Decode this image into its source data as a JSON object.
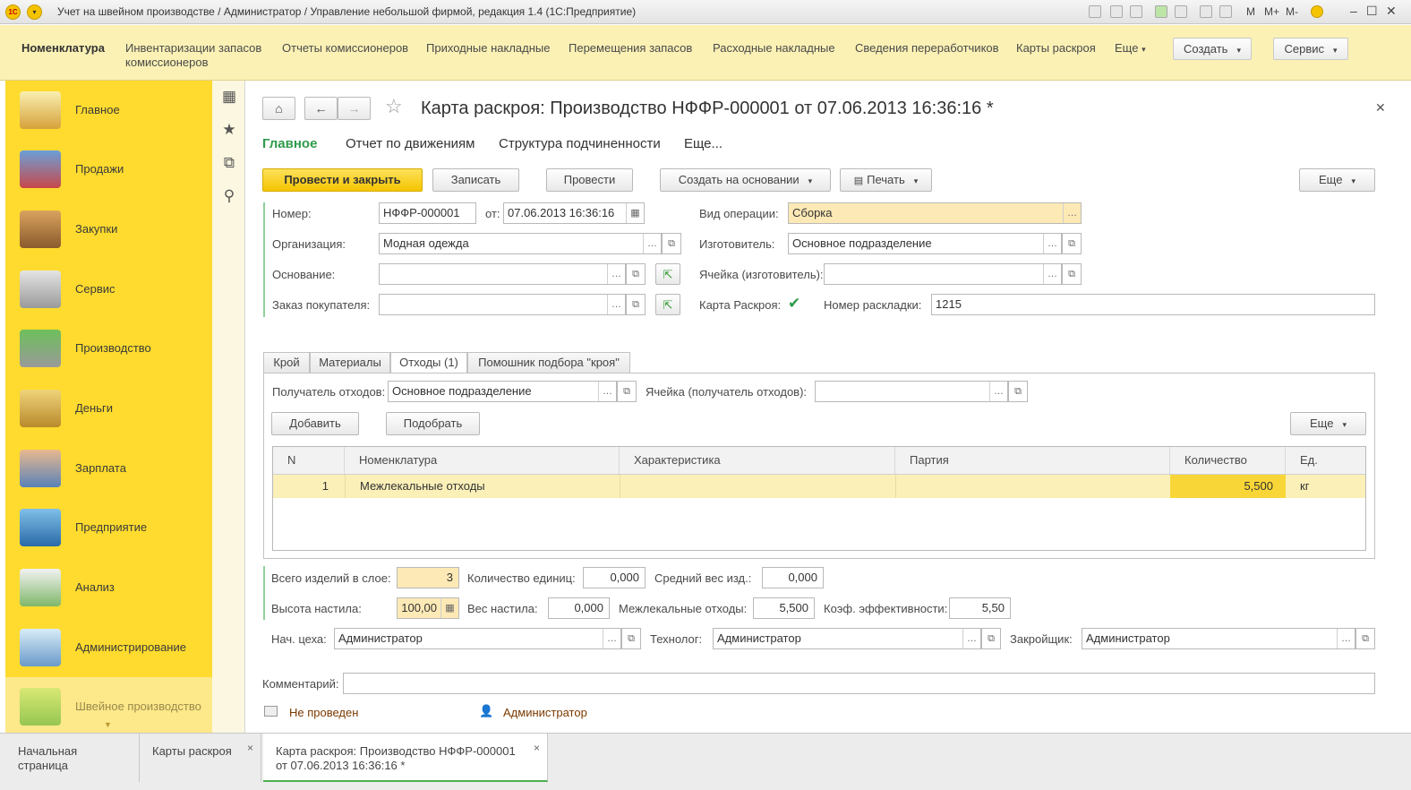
{
  "window": {
    "title": "Учет на швейном производстве / Администратор / Управление небольшой фирмой, редакция 1.4  (1С:Предприятие)",
    "logo_text": "1С",
    "m_labels": [
      "M",
      "M+",
      "M-"
    ]
  },
  "sections": {
    "items": [
      {
        "label": "Номенклатура"
      },
      {
        "label": "Инвентаризации запасов комиссионеров"
      },
      {
        "label": "Отчеты комиссионеров"
      },
      {
        "label": "Приходные накладные"
      },
      {
        "label": "Перемещения запасов"
      },
      {
        "label": "Расходные накладные"
      },
      {
        "label": "Сведения переработчиков"
      },
      {
        "label": "Карты раскроя"
      },
      {
        "label": "Еще"
      }
    ],
    "create_label": "Создать",
    "service_label": "Сервис"
  },
  "nav": [
    {
      "label": "Главное",
      "icon": "desk-lamp-icon"
    },
    {
      "label": "Продажи",
      "icon": "basket-icon"
    },
    {
      "label": "Закупки",
      "icon": "boxes-icon"
    },
    {
      "label": "Сервис",
      "icon": "tools-icon"
    },
    {
      "label": "Производство",
      "icon": "factory-icon"
    },
    {
      "label": "Деньги",
      "icon": "coins-icon"
    },
    {
      "label": "Зарплата",
      "icon": "person-coins-icon"
    },
    {
      "label": "Предприятие",
      "icon": "building-icon"
    },
    {
      "label": "Анализ",
      "icon": "chart-icon"
    },
    {
      "label": "Администрирование",
      "icon": "computer-icon"
    },
    {
      "label": "Швейное производство",
      "icon": "sewing-icon"
    }
  ],
  "doc": {
    "title": "Карта раскроя: Производство НФФР-000001 от 07.06.2013 16:36:16 *",
    "subtabs": [
      "Главное",
      "Отчет по движениям",
      "Структура подчиненности",
      "Еще..."
    ],
    "toolbar": {
      "post_close": "Провести и закрыть",
      "save": "Записать",
      "post": "Провести",
      "create_based": "Создать на основании",
      "print": "Печать",
      "more": "Еще"
    },
    "fields": {
      "number_label": "Номер:",
      "number": "НФФР-000001",
      "from_label": "от:",
      "date": "07.06.2013 16:36:16",
      "org_label": "Организация:",
      "org": "Модная одежда",
      "basis_label": "Основание:",
      "basis": "",
      "order_label": "Заказ покупателя:",
      "order": "",
      "op_label": "Вид операции:",
      "op": "Сборка",
      "maker_label": "Изготовитель:",
      "maker": "Основное подразделение",
      "cell_label": "Ячейка (изготовитель):",
      "cell": "",
      "card_label": "Карта Раскроя:",
      "layout_label": "Номер раскладки:",
      "layout": "1215"
    },
    "tabs": [
      "Крой",
      "Материалы",
      "Отходы (1)",
      "Помошник подбора \"кроя\""
    ],
    "waste": {
      "recipient_label": "Получатель отходов:",
      "recipient": "Основное подразделение",
      "cell_label": "Ячейка (получатель отходов):",
      "cell": "",
      "add": "Добавить",
      "pick": "Подобрать",
      "more": "Еще"
    },
    "grid": {
      "headers": [
        "N",
        "Номенклатура",
        "Характеристика",
        "Партия",
        "Количество",
        "Ед."
      ],
      "rows": [
        {
          "n": "1",
          "item": "Межлекальные отходы",
          "char": "",
          "batch": "",
          "qty": "5,500",
          "unit": "кг"
        }
      ]
    },
    "totals": {
      "items_label": "Всего изделий в слое:",
      "items": "3",
      "units_label": "Количество единиц:",
      "units": "0,000",
      "avgw_label": "Средний вес изд.:",
      "avgw": "0,000",
      "height_label": "Высота настила:",
      "height": "100,00",
      "weight_label": "Вес настила:",
      "weight": "0,000",
      "waste_label": "Межлекальные отходы:",
      "waste": "5,500",
      "eff_label": "Коэф. эффективности:",
      "eff": "5,50",
      "chief_label": "Нач. цеха:",
      "chief": "Администратор",
      "tech_label": "Технолог:",
      "tech": "Администратор",
      "cutter_label": "Закройщик:",
      "cutter": "Администратор"
    },
    "comment_label": "Комментарий:",
    "comment": "",
    "status": "Не проведен",
    "author": "Администратор"
  },
  "bottom_tabs": [
    {
      "label": "Начальная страница"
    },
    {
      "label": "Карты раскроя"
    },
    {
      "label": "Карта раскроя: Производство НФФР-000001 от 07.06.2013 16:36:16 *"
    }
  ],
  "colors": {
    "accent": "#fedb2e",
    "primary_button": "#f5c400",
    "green_link": "#2e9b4b",
    "row_highlight": "#fbf0b8"
  }
}
